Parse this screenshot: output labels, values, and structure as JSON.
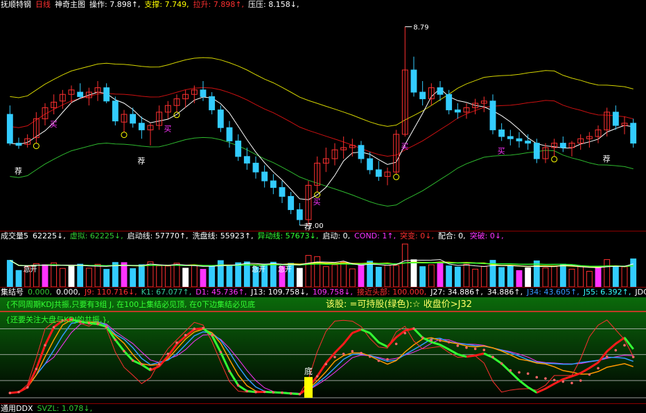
{
  "main": {
    "items": [
      {
        "label": "抚顺特钢",
        "color": "#ffffff"
      },
      {
        "label": "日线",
        "color": "#ff3030"
      },
      {
        "label": "神奇主图",
        "color": "#ffffff"
      },
      {
        "label": "操作: 7.898↑,",
        "color": "#ffffff"
      },
      {
        "label": "支撑: 7.749,",
        "color": "#ffff00"
      },
      {
        "label": "拉升: 7.898↑,",
        "color": "#ff3030"
      },
      {
        "label": "压压: 8.158↓,",
        "color": "#ffffff"
      }
    ],
    "price_high_label": "8.79",
    "price_low_label": "7.00",
    "tag_recommend": "荐",
    "tag_buy": "买"
  },
  "volume": {
    "items": [
      {
        "label": "成交量5",
        "color": "#ffffff"
      },
      {
        "label": "62225↓,",
        "color": "#ffffff"
      },
      {
        "label": "虚拟: 62225↓,",
        "color": "#33cc33"
      },
      {
        "label": "启动线: 57770↑,",
        "color": "#ffffff"
      },
      {
        "label": "洗盘线: 55923↑,",
        "color": "#ffffff"
      },
      {
        "label": "异动线: 57673↓,",
        "color": "#33ff33"
      },
      {
        "label": "启动: 0,",
        "color": "#ffffff"
      },
      {
        "label": "COND: 1↑,",
        "color": "#ff33ff"
      },
      {
        "label": "突变: 0↓,",
        "color": "#ff3030"
      },
      {
        "label": "配合: 0,",
        "color": "#ffffff"
      },
      {
        "label": "突破: 0↓,",
        "color": "#ff33ff"
      }
    ],
    "tag_acc": "急开"
  },
  "kdj": {
    "items": [
      {
        "label": "集结号",
        "color": "#ffffff"
      },
      {
        "label": "0.000,",
        "color": "#33cc33"
      },
      {
        "label": "0.000,",
        "color": "#ffffff"
      },
      {
        "label": "J9: 110.716↓,",
        "color": "#ff3030"
      },
      {
        "label": "K1: 67.077↑,",
        "color": "#33cc99"
      },
      {
        "label": "D1: 45.736↑,",
        "color": "#ff33ff"
      },
      {
        "label": "J13: 109.758↓,",
        "color": "#ffffff"
      },
      {
        "label": "109.758↓,",
        "color": "#ff33ff"
      },
      {
        "label": "接近头部: 100.000,",
        "color": "#ff3030"
      },
      {
        "label": "J27: 34.886↑,",
        "color": "#ffffff"
      },
      {
        "label": "34.886↑,",
        "color": "#ffffff"
      },
      {
        "label": "J34: 43.605↑,",
        "color": "#3399ff"
      },
      {
        "label": "J55: 6.392↑,",
        "color": "#33ffff"
      },
      {
        "label": "JDC:",
        "color": "#ffffff"
      }
    ],
    "note1": "{不同周期KDJ共振,只要有3组 J, 在100上集结必见顶, 在0下边集结必见底",
    "note1b": "该股: =可持股(绿色):☆ 收盘价>J32",
    "note2": "{还要关注大盘与KDJ的共振,},",
    "bottom_tag": "底"
  },
  "ddx": {
    "items": [
      {
        "label": "通用DDX",
        "color": "#ffffff"
      },
      {
        "label": "SVZL: 1.078↓,",
        "color": "#33cc33"
      }
    ]
  },
  "chart_data": {
    "type": "candlestick",
    "ohlc": [
      [
        8.0,
        8.08,
        7.72,
        7.74
      ],
      [
        7.74,
        7.79,
        7.69,
        7.72
      ],
      [
        7.73,
        7.82,
        7.7,
        7.78
      ],
      [
        7.79,
        8.02,
        7.74,
        7.96
      ],
      [
        7.96,
        8.1,
        7.9,
        8.06
      ],
      [
        8.06,
        8.18,
        8.0,
        8.11
      ],
      [
        8.12,
        8.22,
        8.05,
        8.18
      ],
      [
        8.18,
        8.26,
        8.1,
        8.22
      ],
      [
        8.2,
        8.28,
        8.14,
        8.16
      ],
      [
        8.15,
        8.24,
        8.08,
        8.2
      ],
      [
        8.2,
        8.3,
        8.12,
        8.24
      ],
      [
        8.24,
        8.28,
        8.1,
        8.12
      ],
      [
        8.12,
        8.16,
        7.9,
        7.94
      ],
      [
        7.93,
        8.04,
        7.84,
        8.0
      ],
      [
        8.0,
        8.06,
        7.88,
        7.92
      ],
      [
        7.92,
        7.98,
        7.78,
        7.86
      ],
      [
        7.86,
        7.92,
        7.72,
        7.9
      ],
      [
        7.9,
        8.08,
        7.86,
        8.02
      ],
      [
        8.02,
        8.12,
        7.96,
        8.08
      ],
      [
        8.08,
        8.18,
        8.02,
        8.14
      ],
      [
        8.14,
        8.22,
        8.06,
        8.18
      ],
      [
        8.18,
        8.26,
        8.1,
        8.22
      ],
      [
        8.22,
        8.3,
        8.12,
        8.16
      ],
      [
        8.16,
        8.2,
        8.0,
        8.04
      ],
      [
        8.04,
        8.08,
        7.84,
        7.88
      ],
      [
        7.88,
        7.94,
        7.7,
        7.76
      ],
      [
        7.76,
        7.82,
        7.58,
        7.62
      ],
      [
        7.62,
        7.7,
        7.5,
        7.56
      ],
      [
        7.56,
        7.62,
        7.42,
        7.48
      ],
      [
        7.48,
        7.54,
        7.34,
        7.4
      ],
      [
        7.4,
        7.46,
        7.28,
        7.34
      ],
      [
        7.34,
        7.4,
        7.2,
        7.26
      ],
      [
        7.26,
        7.3,
        7.1,
        7.14
      ],
      [
        7.14,
        7.2,
        7.0,
        7.05
      ],
      [
        7.05,
        7.4,
        7.0,
        7.36
      ],
      [
        7.36,
        7.62,
        7.3,
        7.56
      ],
      [
        7.56,
        7.7,
        7.48,
        7.6
      ],
      [
        7.6,
        7.74,
        7.54,
        7.68
      ],
      [
        7.68,
        7.8,
        7.6,
        7.7
      ],
      [
        7.7,
        7.78,
        7.62,
        7.72
      ],
      [
        7.72,
        7.76,
        7.56,
        7.6
      ],
      [
        7.6,
        7.66,
        7.46,
        7.5
      ],
      [
        7.5,
        7.58,
        7.4,
        7.44
      ],
      [
        7.44,
        7.52,
        7.36,
        7.48
      ],
      [
        7.48,
        7.86,
        7.46,
        7.82
      ],
      [
        7.82,
        8.79,
        7.8,
        8.4
      ],
      [
        8.4,
        8.52,
        8.16,
        8.2
      ],
      [
        8.2,
        8.3,
        8.08,
        8.14
      ],
      [
        8.14,
        8.28,
        8.08,
        8.24
      ],
      [
        8.24,
        8.3,
        8.12,
        8.18
      ],
      [
        8.18,
        8.22,
        8.0,
        8.04
      ],
      [
        8.04,
        8.1,
        7.96,
        8.02
      ],
      [
        8.02,
        8.1,
        7.96,
        8.06
      ],
      [
        8.06,
        8.14,
        8.0,
        8.1
      ],
      [
        8.1,
        8.16,
        8.02,
        8.12
      ],
      [
        8.12,
        8.18,
        7.82,
        7.86
      ],
      [
        7.86,
        7.92,
        7.76,
        7.8
      ],
      [
        7.8,
        7.86,
        7.72,
        7.78
      ],
      [
        7.78,
        7.84,
        7.7,
        7.76
      ],
      [
        7.76,
        7.82,
        7.68,
        7.74
      ],
      [
        7.74,
        7.78,
        7.56,
        7.6
      ],
      [
        7.6,
        7.74,
        7.56,
        7.7
      ],
      [
        7.7,
        7.78,
        7.62,
        7.74
      ],
      [
        7.74,
        7.8,
        7.66,
        7.7
      ],
      [
        7.7,
        7.76,
        7.62,
        7.74
      ],
      [
        7.74,
        7.82,
        7.68,
        7.78
      ],
      [
        7.78,
        7.84,
        7.7,
        7.8
      ],
      [
        7.8,
        7.9,
        7.74,
        7.86
      ],
      [
        7.86,
        8.06,
        7.8,
        8.02
      ],
      [
        8.02,
        8.08,
        7.86,
        7.9
      ],
      [
        7.9,
        7.98,
        7.82,
        7.92
      ],
      [
        7.92,
        7.96,
        7.7,
        7.74
      ]
    ],
    "price_range": [
      6.95,
      8.95
    ]
  }
}
